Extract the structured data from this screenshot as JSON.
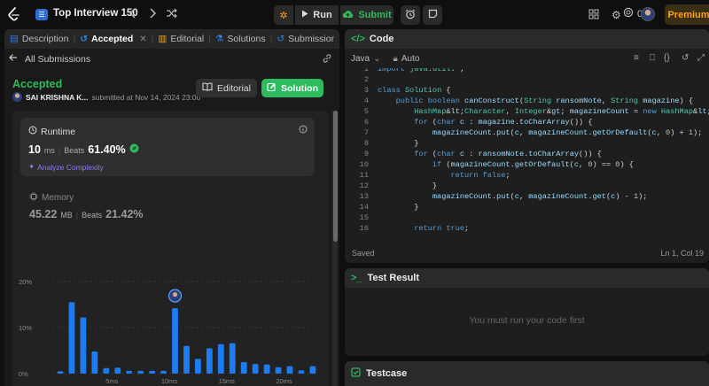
{
  "topbar": {
    "problem_list_title": "Top Interview 150",
    "run_label": "Run",
    "submit_label": "Submit",
    "coins": "0",
    "premium_label": "Premium"
  },
  "left_tabs": [
    {
      "label": "Description"
    },
    {
      "label": "Accepted"
    },
    {
      "label": "Editorial"
    },
    {
      "label": "Solutions"
    },
    {
      "label": "Submissions"
    }
  ],
  "submission": {
    "back_label": "All Submissions",
    "status": "Accepted",
    "user": "SAI KRISHNA K...",
    "submitted_text": "submitted at Nov 14, 2024 23:00",
    "editorial_btn": "Editorial",
    "solution_btn": "Solution"
  },
  "runtime": {
    "title": "Runtime",
    "value": "10",
    "unit": "ms",
    "beats_label": "Beats",
    "beats_pct": "61.40%",
    "analyze_label": "Analyze Complexity"
  },
  "memory": {
    "title": "Memory",
    "value": "45.22",
    "unit": "MB",
    "beats_label": "Beats",
    "beats_pct": "21.42%"
  },
  "chart_data": {
    "type": "bar",
    "yticks": [
      "20%",
      "10%",
      "0%"
    ],
    "xticks": [
      "5ms",
      "10ms",
      "15ms",
      "20ms"
    ],
    "ylim": [
      0,
      20
    ],
    "x": [
      1,
      2,
      3,
      4,
      5,
      6,
      7,
      8,
      9,
      10,
      11,
      12,
      13,
      14,
      15,
      16,
      17,
      18,
      19,
      20,
      21,
      22,
      23
    ],
    "values": [
      0.5,
      15.5,
      12.2,
      4.8,
      1.2,
      1.3,
      0.6,
      0.6,
      0.6,
      0.6,
      14.2,
      6,
      3.2,
      5.5,
      6.4,
      6.6,
      2.5,
      2.1,
      2,
      1.4,
      1.6,
      0.7,
      1.6
    ],
    "highlight_x": 10,
    "grid": true,
    "bar_color": "#1d7cf2"
  },
  "editor": {
    "header": "Code",
    "language": "Java",
    "auto_label": "Auto",
    "status_left": "Saved",
    "status_right": "Ln 1, Col 19",
    "lines": [
      {
        "n": "1",
        "code": "import java.util.*;"
      },
      {
        "n": "2",
        "code": ""
      },
      {
        "n": "3",
        "code": "class Solution {"
      },
      {
        "n": "4",
        "code": "    public boolean canConstruct(String ransomNote, String magazine) {"
      },
      {
        "n": "5",
        "code": "        HashMap<Character, Integer> magazineCount = new HashMap<>();"
      },
      {
        "n": "6",
        "code": "        for (char c : magazine.toCharArray()) {"
      },
      {
        "n": "7",
        "code": "            magazineCount.put(c, magazineCount.getOrDefault(c, 0) + 1);"
      },
      {
        "n": "8",
        "code": "        }"
      },
      {
        "n": "9",
        "code": "        for (char c : ransomNote.toCharArray()) {"
      },
      {
        "n": "10",
        "code": "            if (magazineCount.getOrDefault(c, 0) == 0) {"
      },
      {
        "n": "11",
        "code": "                return false;"
      },
      {
        "n": "12",
        "code": "            }"
      },
      {
        "n": "13",
        "code": "            magazineCount.put(c, magazineCount.get(c) - 1);"
      },
      {
        "n": "14",
        "code": "        }"
      },
      {
        "n": "15",
        "code": ""
      },
      {
        "n": "16",
        "code": "        return true;"
      }
    ]
  },
  "test_result": {
    "header": "Test Result",
    "empty_message": "You must run your code first"
  },
  "testcase": {
    "header": "Testcase"
  },
  "colors": {
    "accent_green": "#2cbb5d",
    "premium_orange": "#ffa116",
    "analyze_purple": "#8b7cf5"
  }
}
